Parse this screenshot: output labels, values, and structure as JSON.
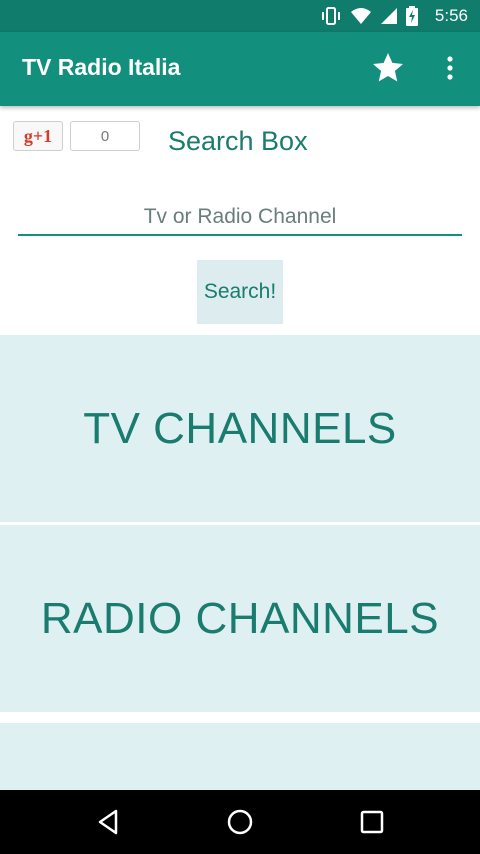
{
  "status_bar": {
    "time": "5:56",
    "icons": [
      "vibrate-icon",
      "wifi-icon",
      "signal-icon",
      "battery-charging-icon"
    ]
  },
  "app_bar": {
    "title": "TV Radio Italia",
    "actions": [
      "star-icon",
      "overflow-menu-icon"
    ]
  },
  "social": {
    "gplus_label": "g+1",
    "count": "0"
  },
  "search": {
    "title": "Search Box",
    "placeholder": "Tv or Radio Channel",
    "value": "",
    "button_label": "Search!"
  },
  "categories": [
    {
      "label": "TV CHANNELS"
    },
    {
      "label": "RADIO CHANNELS"
    }
  ],
  "nav_bar": {
    "buttons": [
      "back-icon",
      "home-icon",
      "recents-icon"
    ]
  },
  "colors": {
    "primary": "#13907d",
    "primary_dark": "#0f7c6c",
    "accent_text": "#1a7b6f",
    "tile_background": "#dff0f3"
  }
}
